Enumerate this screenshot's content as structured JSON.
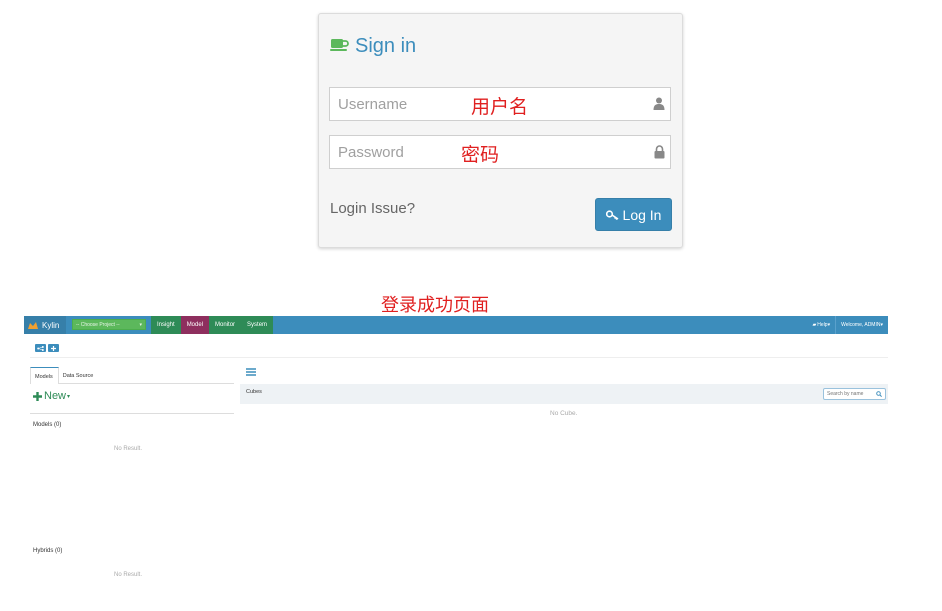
{
  "login": {
    "title": "Sign in",
    "username_placeholder": "Username",
    "password_placeholder": "Password",
    "username_overlay": "用户名",
    "password_overlay": "密码",
    "login_issue": "Login Issue?",
    "login_button": "Log In",
    "accent_color": "#3c8dbc",
    "icon_color": "#5cb85c"
  },
  "caption": "登录成功页面",
  "app": {
    "brand": "Kylin",
    "project_select": "-- Choose Project --",
    "nav": [
      {
        "label": "Insight"
      },
      {
        "label": "Model"
      },
      {
        "label": "Monitor"
      },
      {
        "label": "System"
      }
    ],
    "active_nav": "Model",
    "help": "Help",
    "welcome": "Welcome, ADMIN",
    "tabs": [
      {
        "label": "Models"
      },
      {
        "label": "Data Source"
      }
    ],
    "new_button": "New",
    "models_title": "Models (0)",
    "models_empty": "No Result.",
    "hybrids_title": "Hybrids (0)",
    "hybrids_empty": "No Result.",
    "cubes_label": "Cubes",
    "search_placeholder": "Search by name",
    "no_cube": "No Cube.",
    "topbar_color": "#3c8dbc",
    "nav_color": "#2e8b57",
    "active_nav_color": "#8e2f5e"
  }
}
